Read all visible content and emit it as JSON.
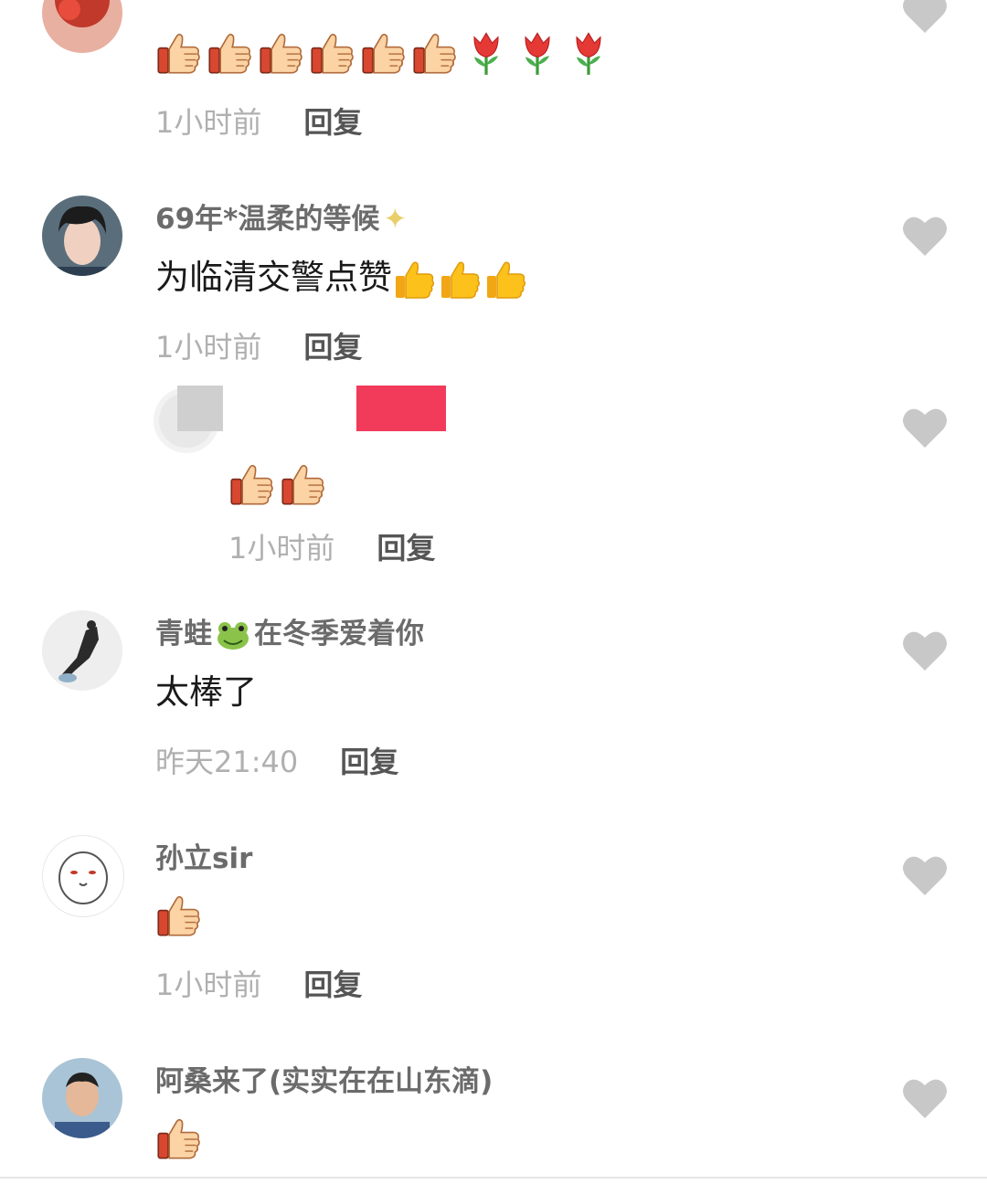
{
  "comments": [
    {
      "time": "1小时前",
      "reply_label": "回复",
      "emojis": [
        "thumbs-up-icon",
        "thumbs-up-icon",
        "thumbs-up-icon",
        "thumbs-up-icon",
        "thumbs-up-icon",
        "thumbs-up-icon",
        "tulip-icon",
        "tulip-icon",
        "tulip-icon"
      ]
    },
    {
      "username": "69年*温柔的等候",
      "username_emoji": "sparkles-icon",
      "text": "为临清交警点赞",
      "text_emojis": [
        "yellow-thumbs-up-icon",
        "yellow-thumbs-up-icon",
        "yellow-thumbs-up-icon"
      ],
      "time": "1小时前",
      "reply_label": "回复"
    },
    {
      "username": "",
      "emojis": [
        "thumbs-up-icon",
        "thumbs-up-icon"
      ],
      "time": "1小时前",
      "reply_label": "回复"
    },
    {
      "username_part1": "青蛙",
      "username_emoji": "frog-face-icon",
      "username_part2": "在冬季爱着你",
      "text": "太棒了",
      "time": "昨天21:40",
      "reply_label": "回复"
    },
    {
      "username": "孙立sir",
      "emojis": [
        "thumbs-up-icon"
      ],
      "time": "1小时前",
      "reply_label": "回复"
    },
    {
      "username": "阿桑来了(实实在在山东滴)",
      "emojis": [
        "thumbs-up-icon"
      ]
    }
  ],
  "colors": {
    "username": "#6b6b6b",
    "text": "#1a1a1a",
    "time": "#b0b0b0",
    "reply": "#555555",
    "like": "#c8c8c8",
    "redaction": "#f23a5a"
  }
}
